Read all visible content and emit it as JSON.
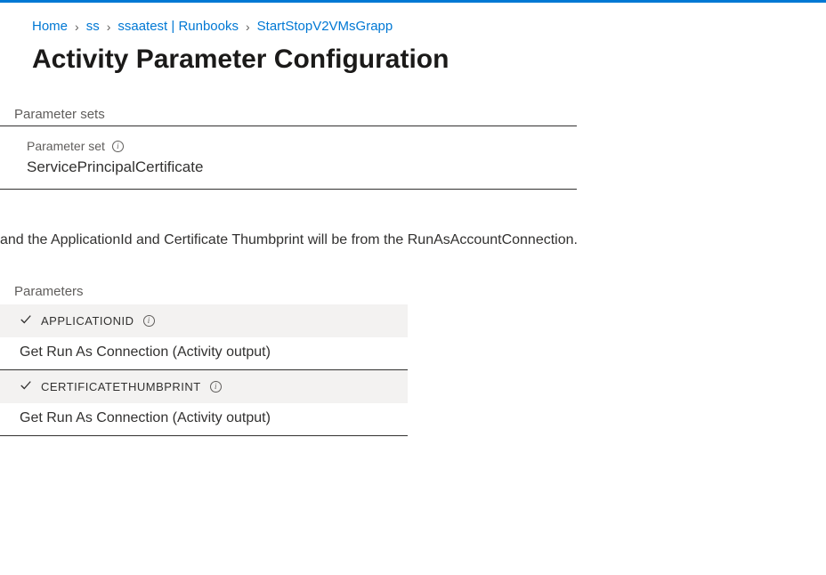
{
  "breadcrumb": {
    "items": [
      {
        "label": "Home"
      },
      {
        "label": "ss"
      },
      {
        "label": "ssaatest | Runbooks"
      },
      {
        "label": "StartStopV2VMsGrapp"
      }
    ]
  },
  "page": {
    "title": "Activity Parameter Configuration"
  },
  "parameter_sets": {
    "section_label": "Parameter sets",
    "field_label": "Parameter set",
    "value": "ServicePrincipalCertificate"
  },
  "description": "and the ApplicationId and Certificate Thumbprint will be from the RunAsAccountConnection.",
  "parameters": {
    "section_label": "Parameters",
    "items": [
      {
        "name": "APPLICATIONID",
        "value": "Get Run As Connection (Activity output)"
      },
      {
        "name": "CERTIFICATETHUMBPRINT",
        "value": "Get Run As Connection (Activity output)"
      }
    ]
  }
}
